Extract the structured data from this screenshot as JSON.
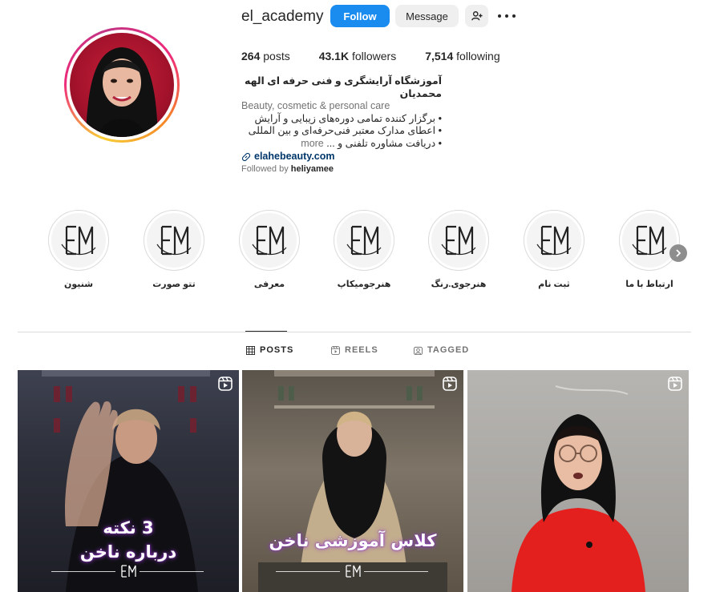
{
  "profile": {
    "username": "el_academy",
    "follow_label": "Follow",
    "message_label": "Message",
    "stats": {
      "posts_count": "264",
      "posts_label": "posts",
      "followers_count": "43.1K",
      "followers_label": "followers",
      "following_count": "7,514",
      "following_label": "following"
    },
    "bio": {
      "name": "آموزشگاه آرایشگری و فنی حرفه ای الهه محمدیان",
      "category": "Beauty, cosmetic & personal care",
      "line1": "• برگزار کننده تمامی دوره‌های زیبایی و آرایش",
      "line2": "• اعطای مدارک معتبر فنی‌حرفه‌ای و بین المللی",
      "line3": "• دریافت مشاوره تلفنی و ...",
      "more_label": "more",
      "link": "elahebeauty.com"
    },
    "followed_by_prefix": "Followed by",
    "followed_by_user": "heliyamee"
  },
  "highlights": [
    {
      "label": "ارتباط با ما"
    },
    {
      "label": "ثبت نام"
    },
    {
      "label": "هنرجوی.رنگ"
    },
    {
      "label": "هنرجومیکاپ"
    },
    {
      "label": "معرفی"
    },
    {
      "label": "تتو صورت"
    },
    {
      "label": "شنیون"
    }
  ],
  "tabs": {
    "posts": "POSTS",
    "reels": "REELS",
    "tagged": "TAGGED"
  },
  "posts": [
    {
      "title_line1": "3 نکته",
      "title_line2": "درباره ناخن"
    },
    {
      "title_line1": "کلاس آموزشی ناخن"
    },
    {}
  ],
  "colors": {
    "follow_button": "#1a8cf0",
    "link": "#00376b",
    "post_title_glow": "#9b3bd6"
  },
  "icons": {
    "add_user": "add-user-icon",
    "more": "more-options-icon",
    "link": "link-icon",
    "posts_tab": "grid-icon",
    "reels_tab": "reels-icon",
    "tagged_tab": "tagged-icon",
    "reel_badge": "reel-icon",
    "next": "chevron-right-icon"
  }
}
